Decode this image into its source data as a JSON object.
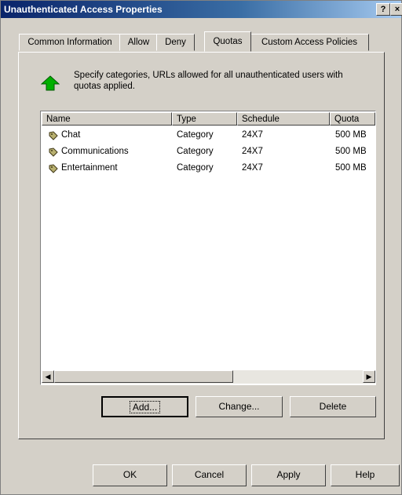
{
  "window": {
    "title": "Unauthenticated Access Properties",
    "help_glyph": "?",
    "close_glyph": "×"
  },
  "tabs": [
    {
      "label": "Common Information",
      "active": false
    },
    {
      "label": "Allow",
      "active": false
    },
    {
      "label": "Deny",
      "active": false
    },
    {
      "label": "Quotas",
      "active": true
    },
    {
      "label": "Custom Access Policies",
      "active": false
    }
  ],
  "info": {
    "icon": "green-up-arrow-icon",
    "text": "Specify categories, URLs allowed for all unauthenticated users with quotas applied."
  },
  "listview": {
    "columns": [
      "Name",
      "Type",
      "Schedule",
      "Quota"
    ],
    "rows": [
      {
        "icon": "category-tag-icon",
        "name": "Chat",
        "type": "Category",
        "schedule": "24X7",
        "quota": "500 MB"
      },
      {
        "icon": "category-tag-icon",
        "name": "Communications",
        "type": "Category",
        "schedule": "24X7",
        "quota": "500 MB"
      },
      {
        "icon": "category-tag-icon",
        "name": "Entertainment",
        "type": "Category",
        "schedule": "24X7",
        "quota": "500 MB"
      }
    ]
  },
  "panel_buttons": {
    "add": "Add...",
    "change": "Change...",
    "delete": "Delete"
  },
  "dialog_buttons": {
    "ok": "OK",
    "cancel": "Cancel",
    "apply": "Apply",
    "help": "Help"
  },
  "colors": {
    "face": "#d4d0c8",
    "title_active": "#0a246a",
    "icon_green": "#00b000"
  }
}
